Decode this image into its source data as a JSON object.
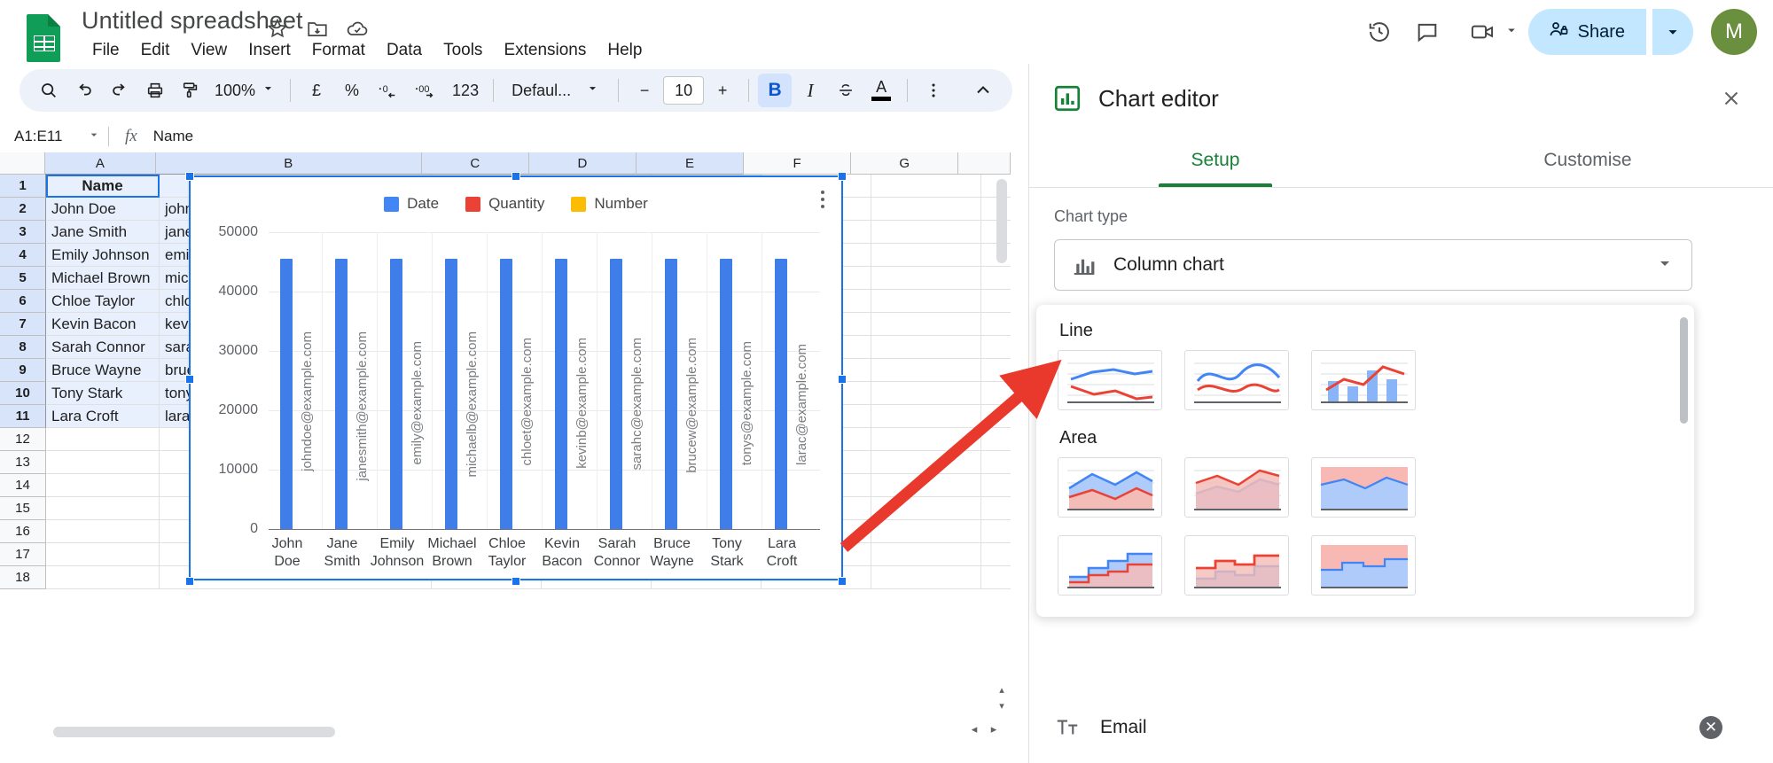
{
  "app": {
    "doc_title": "Untitled spreadsheet",
    "logo_icon": "sheets-logo-icon",
    "title_icons": [
      "star-icon",
      "move-to-folder-icon",
      "cloud-saved-icon"
    ],
    "menus": [
      "File",
      "Edit",
      "View",
      "Insert",
      "Format",
      "Data",
      "Tools",
      "Extensions",
      "Help"
    ],
    "top_right": {
      "history_icon": "version-history-icon",
      "comment_icon": "comment-icon",
      "meet_icon": "video-call-icon",
      "meet_caret": "chevron-down-icon",
      "share_label": "Share",
      "share_icon": "lock-person-icon",
      "share_caret": "chevron-down-icon",
      "avatar_initial": "M",
      "avatar_color": "#6a8f3f"
    }
  },
  "toolbar": {
    "search_icon": "search-icon",
    "undo_icon": "undo-icon",
    "redo_icon": "redo-icon",
    "print_icon": "print-icon",
    "paint_icon": "paint-format-icon",
    "zoom_value": "100%",
    "zoom_caret": "chevron-down-icon",
    "currency_label": "£",
    "percent_label": "%",
    "decrease_decimal": ".0",
    "increase_decimal": ".00",
    "more_formats": "123",
    "font_name": "Defaul...",
    "font_caret": "chevron-down-icon",
    "font_decrease": "−",
    "font_size": "10",
    "font_increase": "+",
    "bold_label": "B",
    "italic_label": "I",
    "strikethrough_icon": "strikethrough-icon",
    "textcolor_label": "A",
    "more_icon": "more-vertical-icon",
    "collapse_icon": "chevron-up-icon"
  },
  "formula_bar": {
    "name_box": "A1:E11",
    "name_caret": "chevron-down-icon",
    "fx_label": "fx",
    "content": "Name"
  },
  "grid": {
    "columns": [
      "A",
      "B",
      "C",
      "D",
      "E",
      "F",
      "G"
    ],
    "selected_columns": [
      "A",
      "B",
      "C",
      "D",
      "E"
    ],
    "row_numbers": [
      "1",
      "2",
      "3",
      "4",
      "5",
      "6",
      "7",
      "8",
      "9",
      "10",
      "11",
      "12",
      "13",
      "14",
      "15",
      "16",
      "17",
      "18"
    ],
    "selected_rows": [
      "1",
      "2",
      "3",
      "4",
      "5",
      "6",
      "7",
      "8",
      "9",
      "10",
      "11"
    ],
    "names": [
      "Name",
      "John Doe",
      "Jane Smith",
      "Emily Johnson",
      "Michael Brown",
      "Chloe Taylor",
      "Kevin Bacon",
      "Sarah Connor",
      "Bruce Wayne",
      "Tony Stark",
      "Lara Croft"
    ],
    "emails_clipped": [
      "",
      "john",
      "jane",
      "emil",
      "mich",
      "chlo",
      "kevi",
      "sara",
      "bruc",
      "tony",
      "larac"
    ]
  },
  "chart": {
    "kebab_icon": "chart-menu-icon",
    "legend": [
      {
        "label": "Date",
        "color": "#4285f4"
      },
      {
        "label": "Quantity",
        "color": "#ea4335"
      },
      {
        "label": "Number",
        "color": "#fbbc04"
      }
    ]
  },
  "chart_data": {
    "type": "bar",
    "title": "",
    "xlabel": "",
    "ylabel": "",
    "ylim": [
      0,
      50000
    ],
    "yticks": [
      0,
      10000,
      20000,
      30000,
      40000,
      50000
    ],
    "ytick_labels": [
      "0",
      "10000",
      "20000",
      "30000",
      "40000",
      "50000"
    ],
    "grid": true,
    "legend_position": "top",
    "categories": [
      "John\nDoe",
      "Jane\nSmith",
      "Emily\nJohnson",
      "Michael\nBrown",
      "Chloe\nTaylor",
      "Kevin\nBacon",
      "Sarah\nConnor",
      "Bruce\nWayne",
      "Tony\nStark",
      "Lara\nCroft"
    ],
    "point_labels": [
      "johndoe@example.com",
      "janesmith@example.com",
      "emily@example.com",
      "michaelb@example.com",
      "chloet@example.com",
      "kevinb@example.com",
      "sarahc@example.com",
      "brucew@example.com",
      "tonys@example.com",
      "larac@example.com"
    ],
    "series": [
      {
        "name": "Date",
        "color": "#4285f4",
        "values": [
          45500,
          45500,
          45500,
          45500,
          45500,
          45500,
          45500,
          45500,
          45500,
          45500
        ]
      },
      {
        "name": "Quantity",
        "color": "#ea4335",
        "values": [
          0,
          0,
          0,
          0,
          0,
          0,
          0,
          0,
          0,
          0
        ]
      },
      {
        "name": "Number",
        "color": "#fbbc04",
        "values": [
          0,
          0,
          0,
          0,
          0,
          0,
          0,
          0,
          0,
          0
        ]
      }
    ]
  },
  "editor": {
    "icon": "chart-editor-icon",
    "title": "Chart editor",
    "close_icon": "close-icon",
    "tabs": [
      {
        "label": "Setup",
        "selected": true
      },
      {
        "label": "Customise",
        "selected": false
      }
    ],
    "chart_type_label": "Chart type",
    "chart_type_value": "Column chart",
    "chart_type_icon": "column-chart-icon",
    "chart_type_caret": "chevron-down-icon",
    "menu": {
      "groups": [
        {
          "title": "Line",
          "thumbs": [
            "line-chart-thumb",
            "smooth-line-chart-thumb",
            "combo-chart-thumb"
          ]
        },
        {
          "title": "Area",
          "thumbs": [
            "area-chart-thumb",
            "stacked-area-chart-thumb",
            "100-stacked-area-thumb",
            "stepped-area-thumb",
            "stacked-stepped-area-thumb",
            "100-stepped-area-thumb"
          ]
        }
      ]
    },
    "bottom_chip": {
      "icon": "text-format-icon",
      "label": "Email",
      "remove_icon": "remove-icon"
    }
  },
  "annotation": {
    "arrow_color": "#e8392c",
    "arrow_name": "red-pointer-arrow"
  }
}
